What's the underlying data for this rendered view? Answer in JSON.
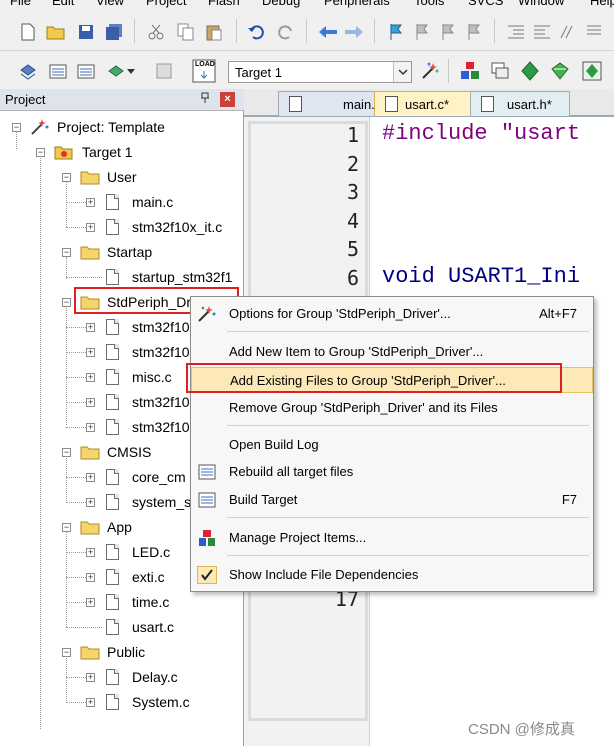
{
  "menubar": {
    "items": [
      "File",
      "Edit",
      "View",
      "Project",
      "Flash",
      "Debug",
      "Peripherals",
      "Tools",
      "SVCS",
      "Window",
      "Help"
    ]
  },
  "toolbar": {
    "target_value": "Target 1",
    "load_label": "LOAD"
  },
  "project_panel": {
    "title": "Project",
    "pin": "❖",
    "close": "×",
    "tree": [
      {
        "label": "Project: Template",
        "kind": "project"
      },
      {
        "label": "Target 1",
        "kind": "target"
      },
      {
        "label": "User",
        "kind": "group"
      },
      {
        "label": "main.c",
        "kind": "file"
      },
      {
        "label": "stm32f10x_it.c",
        "kind": "file"
      },
      {
        "label": "Startap",
        "kind": "group"
      },
      {
        "label": "startup_stm32f1",
        "kind": "file"
      },
      {
        "label": "StdPeriph_Dri",
        "kind": "group"
      },
      {
        "label": "stm32f10",
        "kind": "file"
      },
      {
        "label": "stm32f10",
        "kind": "file"
      },
      {
        "label": "misc.c",
        "kind": "file"
      },
      {
        "label": "stm32f10",
        "kind": "file"
      },
      {
        "label": "stm32f10",
        "kind": "file"
      },
      {
        "label": "CMSIS",
        "kind": "group"
      },
      {
        "label": "core_cm",
        "kind": "file"
      },
      {
        "label": "system_s",
        "kind": "file"
      },
      {
        "label": "App",
        "kind": "group"
      },
      {
        "label": "LED.c",
        "kind": "file"
      },
      {
        "label": "exti.c",
        "kind": "file"
      },
      {
        "label": "time.c",
        "kind": "file"
      },
      {
        "label": "usart.c",
        "kind": "file"
      },
      {
        "label": "Public",
        "kind": "group"
      },
      {
        "label": "Delay.c",
        "kind": "file"
      },
      {
        "label": "System.c",
        "kind": "file"
      }
    ]
  },
  "tabs": [
    {
      "label": "main.c",
      "active": false
    },
    {
      "label": "usart.c*",
      "active": true
    },
    {
      "label": "usart.h*",
      "active": false
    }
  ],
  "editor": {
    "line_numbers": [
      "1",
      "2",
      "3",
      "4",
      "5",
      "6",
      "17"
    ],
    "code_lines": [
      "#include \"usart",
      "void USART1_Ini"
    ]
  },
  "context_menu": {
    "items": [
      {
        "label": "Options for Group 'StdPeriph_Driver'...",
        "shortcut": "Alt+F7",
        "icon": "options-wand-icon"
      },
      {
        "label": "Add New  Item to Group 'StdPeriph_Driver'...",
        "shortcut": ""
      },
      {
        "label": "Add Existing Files to Group 'StdPeriph_Driver'...",
        "shortcut": "",
        "highlighted": true
      },
      {
        "label": "Remove Group 'StdPeriph_Driver' and its Files",
        "shortcut": ""
      },
      {
        "label": "Open Build Log",
        "shortcut": ""
      },
      {
        "label": "Rebuild all target files",
        "shortcut": "",
        "icon": "rebuild-icon"
      },
      {
        "label": "Build Target",
        "shortcut": "F7",
        "icon": "build-icon"
      },
      {
        "label": "Manage Project Items...",
        "shortcut": "",
        "icon": "manage-items-icon"
      },
      {
        "label": "Show Include File Dependencies",
        "shortcut": "",
        "icon": "checkmark-icon",
        "checked": true
      }
    ]
  },
  "watermark": "CSDN @修成真",
  "colors": {
    "highlight_bg": "#fde9b8",
    "annotation_red": "#e02020",
    "keyword": "#00007f",
    "string": "#7f007f"
  }
}
